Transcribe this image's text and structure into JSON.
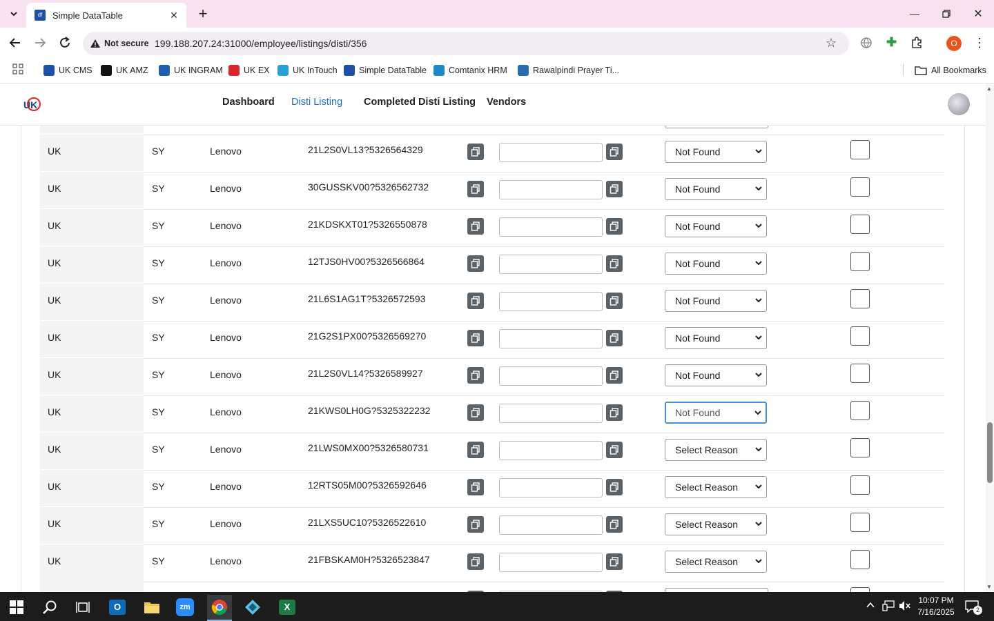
{
  "browser": {
    "tab_title": "Simple DataTable",
    "security_label": "Not secure",
    "url": "199.188.207.24:31000/employee/listings/disti/356",
    "profile_initial": "O",
    "all_bookmarks": "All Bookmarks",
    "bookmarks": [
      {
        "label": "UK CMS",
        "color": "#1f4fa6"
      },
      {
        "label": "UK AMZ",
        "color": "#111111"
      },
      {
        "label": "UK INGRAM",
        "color": "#1f5fae"
      },
      {
        "label": "UK EX",
        "color": "#d9262b"
      },
      {
        "label": "UK InTouch",
        "color": "#2aa0d8"
      },
      {
        "label": "Simple DataTable",
        "color": "#1f4fa6"
      },
      {
        "label": "Comtanix HRM",
        "color": "#1e88c8"
      },
      {
        "label": "Rawalpindi Prayer Ti...",
        "color": "#2b6cb0"
      }
    ]
  },
  "app": {
    "logo_text": "UK",
    "nav": [
      {
        "label": "Dashboard"
      },
      {
        "label": "Disti Listing"
      },
      {
        "label": "Completed Disti Listing"
      },
      {
        "label": "Vendors"
      }
    ]
  },
  "table": {
    "rows": [
      {
        "region": "UK",
        "code": "SY",
        "brand": "Lenovo",
        "sku": "21L2S0VL13?5326564329",
        "reason": "Not Found"
      },
      {
        "region": "UK",
        "code": "SY",
        "brand": "Lenovo",
        "sku": "30GUSSKV00?5326562732",
        "reason": "Not Found"
      },
      {
        "region": "UK",
        "code": "SY",
        "brand": "Lenovo",
        "sku": "21KDSKXT01?5326550878",
        "reason": "Not Found"
      },
      {
        "region": "UK",
        "code": "SY",
        "brand": "Lenovo",
        "sku": "12TJS0HV00?5326566864",
        "reason": "Not Found"
      },
      {
        "region": "UK",
        "code": "SY",
        "brand": "Lenovo",
        "sku": "21L6S1AG1T?5326572593",
        "reason": "Not Found"
      },
      {
        "region": "UK",
        "code": "SY",
        "brand": "Lenovo",
        "sku": "21G2S1PX00?5326569270",
        "reason": "Not Found"
      },
      {
        "region": "UK",
        "code": "SY",
        "brand": "Lenovo",
        "sku": "21L2S0VL14?5326589927",
        "reason": "Not Found"
      },
      {
        "region": "UK",
        "code": "SY",
        "brand": "Lenovo",
        "sku": "21KWS0LH0G?5325322232",
        "reason": "Not Found"
      },
      {
        "region": "UK",
        "code": "SY",
        "brand": "Lenovo",
        "sku": "21LWS0MX00?5326580731",
        "reason": "Select Reason"
      },
      {
        "region": "UK",
        "code": "SY",
        "brand": "Lenovo",
        "sku": "12RTS05M00?5326592646",
        "reason": "Select Reason"
      },
      {
        "region": "UK",
        "code": "SY",
        "brand": "Lenovo",
        "sku": "21LXS5UC10?5326522610",
        "reason": "Select Reason"
      },
      {
        "region": "UK",
        "code": "SY",
        "brand": "Lenovo",
        "sku": "21FBSKAM0H?5326523847",
        "reason": "Select Reason"
      }
    ]
  },
  "taskbar": {
    "time": "10:07 PM",
    "date": "7/16/2025",
    "notification_count": "2"
  },
  "colors": {
    "accent": "#1f6fc2",
    "tab_strip": "#f9e2ef",
    "copy_button": "#5a6268"
  }
}
